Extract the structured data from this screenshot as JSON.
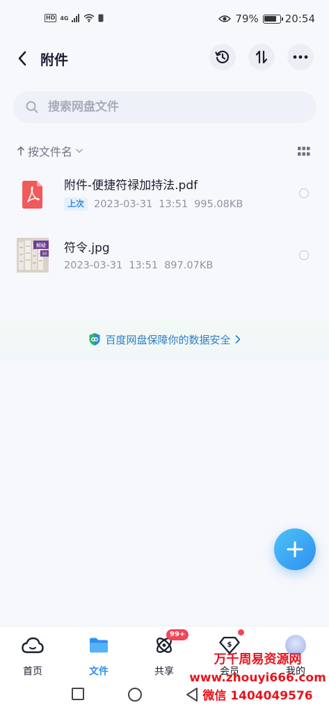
{
  "status_bar": {
    "hd": "HD",
    "network": "4G",
    "battery_percent": "79%",
    "battery_level": 0.79,
    "time": "20:54"
  },
  "header": {
    "title": "附件",
    "back_icon": "chevron-left-icon",
    "history_icon": "history-icon",
    "sort_icon": "sort-arrows-icon",
    "more_icon": "more-dots-icon"
  },
  "search": {
    "placeholder": "搜索网盘文件"
  },
  "sort": {
    "label": "按文件名",
    "direction_icon": "arrow-up-icon"
  },
  "files": [
    {
      "name": "附件-便捷符禄加持法.pdf",
      "tag": "上次",
      "date": "2023-03-31",
      "time": "13:51",
      "size": "995.08KB",
      "icon": "pdf-icon"
    },
    {
      "name": "符令.jpg",
      "date": "2023-03-31",
      "time": "13:51",
      "size": "897.07KB",
      "icon": "image-thumbnail",
      "thumb_label_1": "解疑",
      "thumb_label_2": "30"
    }
  ],
  "banner": {
    "text": "百度网盘保障你的数据安全",
    "icon": "shield-icon"
  },
  "nav": {
    "items": [
      {
        "label": "首页",
        "icon": "home-cloud-icon",
        "active": false
      },
      {
        "label": "文件",
        "icon": "folder-icon",
        "active": true
      },
      {
        "label": "共享",
        "icon": "share-orbit-icon",
        "active": false,
        "badge": "99+"
      },
      {
        "label": "会员",
        "icon": "vip-diamond-icon",
        "active": false
      },
      {
        "label": "我的",
        "icon": "avatar",
        "active": false
      }
    ]
  },
  "watermark": {
    "line1": "万千周易资源网",
    "line2": "www.zhouyi666.com",
    "line3": "微信 1404049576"
  },
  "colors": {
    "accent": "#2f8ff0",
    "background": "#f7f8fc",
    "pdf_red": "#f05a5a",
    "badge_red": "#f04657",
    "banner_text": "#2d7fc6"
  }
}
